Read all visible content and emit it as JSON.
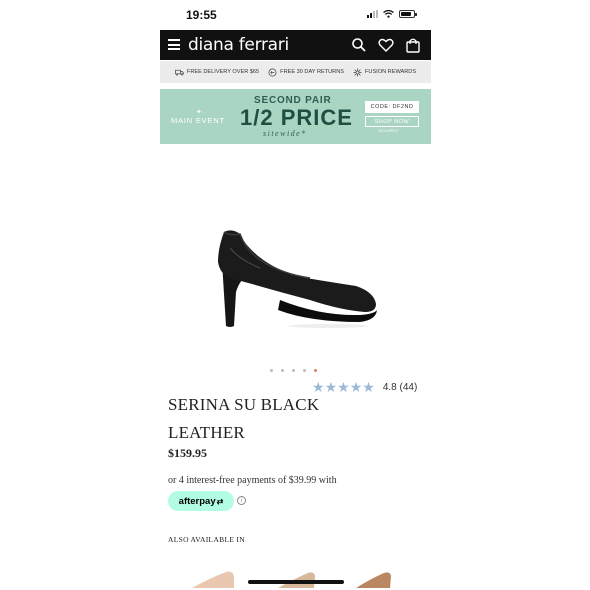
{
  "status_bar": {
    "time": "19:55"
  },
  "header": {
    "logo": "diana ferrari",
    "icons": [
      "menu-icon",
      "search-icon",
      "heart-icon",
      "bag-icon"
    ]
  },
  "perks": [
    {
      "icon": "truck-icon",
      "label": "FREE DELIVERY OVER $65"
    },
    {
      "icon": "return-icon",
      "label": "FREE 30 DAY RETURNS"
    },
    {
      "icon": "sparkle-icon",
      "label": "FUSION REWARDS"
    }
  ],
  "promo": {
    "event": "MAIN EVENT",
    "headline": "SECOND PAIR",
    "offer": "1/2 PRICE",
    "scope": "sitewide*",
    "code": "CODE: DF2ND",
    "cta": "SHOP NOW",
    "fine_print": "T&Cs APPLY",
    "color": "#a9d5c2"
  },
  "product": {
    "image_icon": "black-pump-shoe",
    "carousel": {
      "count": 5,
      "active_index": 4
    },
    "rating": {
      "value": 4.8,
      "label": "4.8 (44)"
    },
    "title": "SERINA SU BLACK LEATHER",
    "price": "$159.95",
    "afterpay_text": "or 4 interest-free payments of $39.99 with",
    "afterpay_badge": "afterpay",
    "afterpay_color": "#b2fce4",
    "also_available": "ALSO AVAILABLE IN"
  }
}
